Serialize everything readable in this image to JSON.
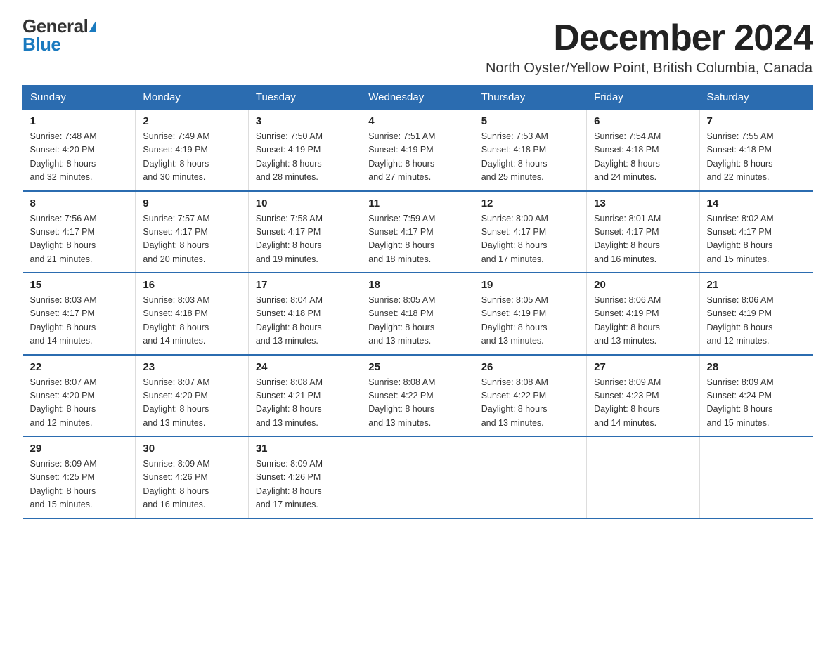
{
  "logo": {
    "general": "General",
    "blue": "Blue"
  },
  "header": {
    "month_year": "December 2024",
    "location": "North Oyster/Yellow Point, British Columbia, Canada"
  },
  "weekdays": [
    "Sunday",
    "Monday",
    "Tuesday",
    "Wednesday",
    "Thursday",
    "Friday",
    "Saturday"
  ],
  "weeks": [
    [
      {
        "day": "1",
        "sunrise": "7:48 AM",
        "sunset": "4:20 PM",
        "daylight": "8 hours and 32 minutes."
      },
      {
        "day": "2",
        "sunrise": "7:49 AM",
        "sunset": "4:19 PM",
        "daylight": "8 hours and 30 minutes."
      },
      {
        "day": "3",
        "sunrise": "7:50 AM",
        "sunset": "4:19 PM",
        "daylight": "8 hours and 28 minutes."
      },
      {
        "day": "4",
        "sunrise": "7:51 AM",
        "sunset": "4:19 PM",
        "daylight": "8 hours and 27 minutes."
      },
      {
        "day": "5",
        "sunrise": "7:53 AM",
        "sunset": "4:18 PM",
        "daylight": "8 hours and 25 minutes."
      },
      {
        "day": "6",
        "sunrise": "7:54 AM",
        "sunset": "4:18 PM",
        "daylight": "8 hours and 24 minutes."
      },
      {
        "day": "7",
        "sunrise": "7:55 AM",
        "sunset": "4:18 PM",
        "daylight": "8 hours and 22 minutes."
      }
    ],
    [
      {
        "day": "8",
        "sunrise": "7:56 AM",
        "sunset": "4:17 PM",
        "daylight": "8 hours and 21 minutes."
      },
      {
        "day": "9",
        "sunrise": "7:57 AM",
        "sunset": "4:17 PM",
        "daylight": "8 hours and 20 minutes."
      },
      {
        "day": "10",
        "sunrise": "7:58 AM",
        "sunset": "4:17 PM",
        "daylight": "8 hours and 19 minutes."
      },
      {
        "day": "11",
        "sunrise": "7:59 AM",
        "sunset": "4:17 PM",
        "daylight": "8 hours and 18 minutes."
      },
      {
        "day": "12",
        "sunrise": "8:00 AM",
        "sunset": "4:17 PM",
        "daylight": "8 hours and 17 minutes."
      },
      {
        "day": "13",
        "sunrise": "8:01 AM",
        "sunset": "4:17 PM",
        "daylight": "8 hours and 16 minutes."
      },
      {
        "day": "14",
        "sunrise": "8:02 AM",
        "sunset": "4:17 PM",
        "daylight": "8 hours and 15 minutes."
      }
    ],
    [
      {
        "day": "15",
        "sunrise": "8:03 AM",
        "sunset": "4:17 PM",
        "daylight": "8 hours and 14 minutes."
      },
      {
        "day": "16",
        "sunrise": "8:03 AM",
        "sunset": "4:18 PM",
        "daylight": "8 hours and 14 minutes."
      },
      {
        "day": "17",
        "sunrise": "8:04 AM",
        "sunset": "4:18 PM",
        "daylight": "8 hours and 13 minutes."
      },
      {
        "day": "18",
        "sunrise": "8:05 AM",
        "sunset": "4:18 PM",
        "daylight": "8 hours and 13 minutes."
      },
      {
        "day": "19",
        "sunrise": "8:05 AM",
        "sunset": "4:19 PM",
        "daylight": "8 hours and 13 minutes."
      },
      {
        "day": "20",
        "sunrise": "8:06 AM",
        "sunset": "4:19 PM",
        "daylight": "8 hours and 13 minutes."
      },
      {
        "day": "21",
        "sunrise": "8:06 AM",
        "sunset": "4:19 PM",
        "daylight": "8 hours and 12 minutes."
      }
    ],
    [
      {
        "day": "22",
        "sunrise": "8:07 AM",
        "sunset": "4:20 PM",
        "daylight": "8 hours and 12 minutes."
      },
      {
        "day": "23",
        "sunrise": "8:07 AM",
        "sunset": "4:20 PM",
        "daylight": "8 hours and 13 minutes."
      },
      {
        "day": "24",
        "sunrise": "8:08 AM",
        "sunset": "4:21 PM",
        "daylight": "8 hours and 13 minutes."
      },
      {
        "day": "25",
        "sunrise": "8:08 AM",
        "sunset": "4:22 PM",
        "daylight": "8 hours and 13 minutes."
      },
      {
        "day": "26",
        "sunrise": "8:08 AM",
        "sunset": "4:22 PM",
        "daylight": "8 hours and 13 minutes."
      },
      {
        "day": "27",
        "sunrise": "8:09 AM",
        "sunset": "4:23 PM",
        "daylight": "8 hours and 14 minutes."
      },
      {
        "day": "28",
        "sunrise": "8:09 AM",
        "sunset": "4:24 PM",
        "daylight": "8 hours and 15 minutes."
      }
    ],
    [
      {
        "day": "29",
        "sunrise": "8:09 AM",
        "sunset": "4:25 PM",
        "daylight": "8 hours and 15 minutes."
      },
      {
        "day": "30",
        "sunrise": "8:09 AM",
        "sunset": "4:26 PM",
        "daylight": "8 hours and 16 minutes."
      },
      {
        "day": "31",
        "sunrise": "8:09 AM",
        "sunset": "4:26 PM",
        "daylight": "8 hours and 17 minutes."
      },
      null,
      null,
      null,
      null
    ]
  ],
  "labels": {
    "sunrise": "Sunrise: ",
    "sunset": "Sunset: ",
    "daylight": "Daylight: "
  }
}
